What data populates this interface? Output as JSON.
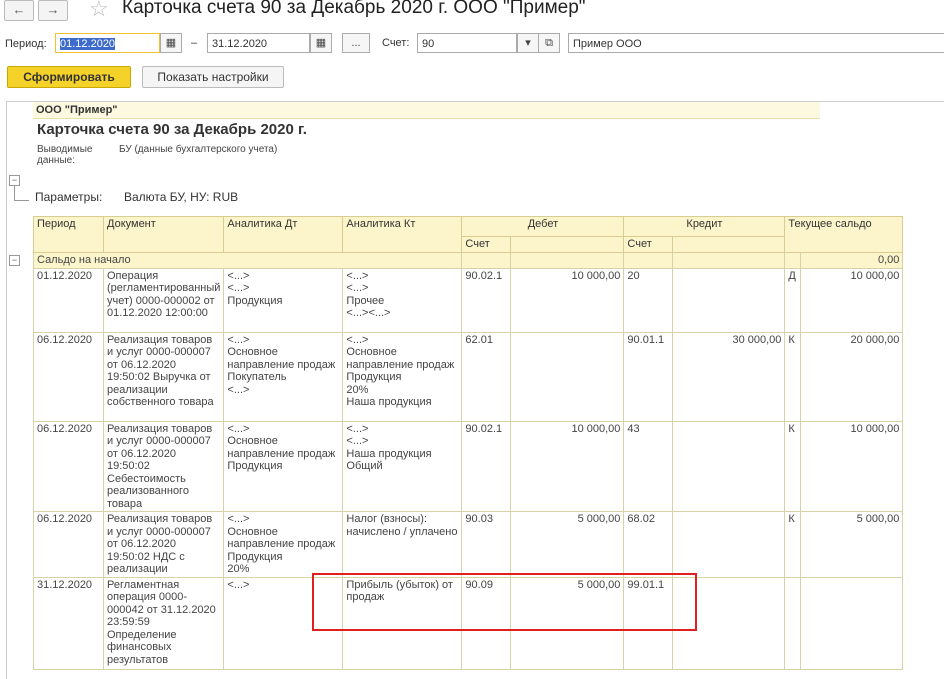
{
  "nav": {
    "back_icon": "←",
    "forward_icon": "→",
    "star_icon": "☆"
  },
  "window_title": "Карточка счета 90 за Декабрь 2020 г. ООО \"Пример\"",
  "filters": {
    "period_label": "Период:",
    "date_from": "01.12.2020",
    "dash": "–",
    "date_to": "31.12.2020",
    "ellipsis_label": "...",
    "account_label": "Счет:",
    "account_value": "90",
    "org_value": "Пример ООО"
  },
  "actions": {
    "generate": "Сформировать",
    "show_settings": "Показать настройки"
  },
  "report": {
    "org": "ООО \"Пример\"",
    "title": "Карточка счета 90 за Декабрь 2020 г.",
    "output_label": "Выводимые данные:",
    "output_value": "БУ (данные бухгалтерского учета)",
    "params_label": "Параметры:",
    "params_value": "Валюта БУ, НУ: RUB",
    "headers": {
      "period": "Период",
      "document": "Документ",
      "an_dt": "Аналитика Дт",
      "an_kt": "Аналитика Кт",
      "debit": "Дебет",
      "credit": "Кредит",
      "balance": "Текущее сальдо",
      "debit_account": "Счет",
      "credit_account": "Счет"
    },
    "opening": {
      "label": "Сальдо на начало",
      "value": "0,00"
    },
    "rows": [
      {
        "period": "01.12.2020",
        "document": "Операция (регламентированный учет) 0000-000002 от 01.12.2020 12:00:00",
        "an_dt": "<...>\n<...>\nПродукция",
        "an_kt": "<...>\n<...>\nПрочее\n<...><...>",
        "dt_acc": "90.02.1",
        "dt_sum": "10 000,00",
        "kt_acc": "20",
        "kt_sum": "",
        "bal_side": "Д",
        "bal_sum": "10 000,00"
      },
      {
        "period": "06.12.2020",
        "document": "Реализация товаров и услуг 0000-000007 от 06.12.2020 19:50:02 Выручка от реализации собственного товара",
        "an_dt": "<...>\nОсновное направление продаж\nПокупатель\n<...>",
        "an_kt": "<...>\nОсновное направление продаж\nПродукция\n20%\nНаша продукция",
        "dt_acc": "62.01",
        "dt_sum": "",
        "kt_acc": "90.01.1",
        "kt_sum": "30 000,00",
        "bal_side": "К",
        "bal_sum": "20 000,00"
      },
      {
        "period": "06.12.2020",
        "document": "Реализация товаров и услуг 0000-000007 от 06.12.2020 19:50:02 Себестоимость реализованного товара",
        "an_dt": "<...>\nОсновное направление продаж\nПродукция",
        "an_kt": "<...>\n<...>\nНаша продукция\nОбщий",
        "dt_acc": "90.02.1",
        "dt_sum": "10 000,00",
        "kt_acc": "43",
        "kt_sum": "",
        "bal_side": "К",
        "bal_sum": "10 000,00"
      },
      {
        "period": "06.12.2020",
        "document": "Реализация товаров и услуг 0000-000007 от 06.12.2020 19:50:02 НДС с реализации",
        "an_dt": "<...>\nОсновное направление продаж\nПродукция\n20%",
        "an_kt": "Налог (взносы): начислено / уплачено",
        "dt_acc": "90.03",
        "dt_sum": "5 000,00",
        "kt_acc": "68.02",
        "kt_sum": "",
        "bal_side": "К",
        "bal_sum": "5 000,00"
      },
      {
        "period": "31.12.2020",
        "document": "Регламентная операция 0000-000042 от 31.12.2020 23:59:59 Определение финансовых результатов",
        "an_dt": "<...>",
        "an_kt": "Прибыль (убыток) от продаж",
        "dt_acc": "90.09",
        "dt_sum": "5 000,00",
        "kt_acc": "99.01.1",
        "kt_sum": "",
        "bal_side": "",
        "bal_sum": ""
      }
    ]
  },
  "colors": {
    "accent": "#f5d22a",
    "highlight_box": "#e02020",
    "header_bg": "#fcf5cc"
  }
}
